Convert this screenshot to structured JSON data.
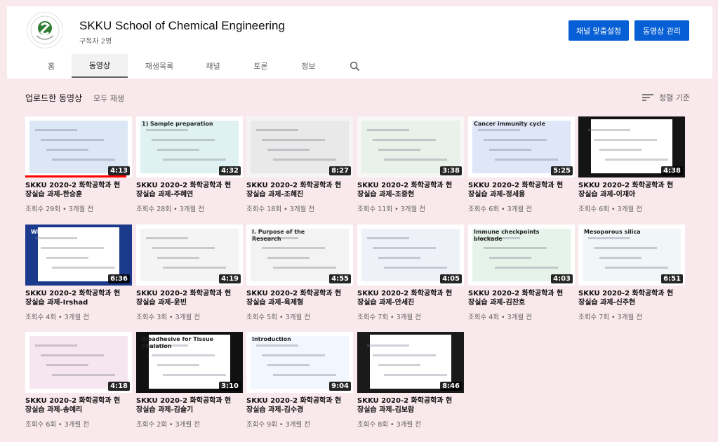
{
  "channel": {
    "name": "SKKU School of Chemical Engineering",
    "subscribers": "구독자 2명",
    "customize_label": "채널 맞춤설정",
    "manage_label": "동영상 관리"
  },
  "tabs": [
    {
      "label": "홈"
    },
    {
      "label": "동영상"
    },
    {
      "label": "재생목록"
    },
    {
      "label": "채널"
    },
    {
      "label": "토론"
    },
    {
      "label": "정보"
    }
  ],
  "section": {
    "title": "업로드한 동영상",
    "play_all": "모두 재생",
    "sort_label": "정렬 기준"
  },
  "videos": [
    {
      "title": "SKKU 2020-2 화학공학과 현장실습 과제-한승훈",
      "duration": "4:13",
      "meta": "조회수 29회 • 3개월 전",
      "watched": 0.95
    },
    {
      "title": "SKKU 2020-2 화학공학과 현장실습 과제-주혜연",
      "duration": "4:32",
      "meta": "조회수 28회 • 3개월 전",
      "watched": 0
    },
    {
      "title": "SKKU 2020-2 화학공학과 현장실습 과제-조혜진",
      "duration": "8:27",
      "meta": "조회수 18회 • 3개월 전",
      "watched": 0
    },
    {
      "title": "SKKU 2020-2 화학공학과 현장실습 과제-조중현",
      "duration": "3:38",
      "meta": "조회수 11회 • 3개월 전",
      "watched": 0
    },
    {
      "title": "SKKU 2020-2 화학공학과 현장실습 과제-정세융",
      "duration": "5:25",
      "meta": "조회수 6회 • 3개월 전",
      "watched": 0
    },
    {
      "title": "SKKU 2020-2 화학공학과 현장실습 과제-이재아",
      "duration": "4:38",
      "meta": "조회수 6회 • 3개월 전",
      "watched": 0
    },
    {
      "title": "SKKU 2020-2 화학공학과 현장실습 과제-Irshad",
      "duration": "6:36",
      "meta": "조회수 4회 • 3개월 전",
      "watched": 0
    },
    {
      "title": "SKKU 2020-2 화학공학과 현장실습 과제-윤빈",
      "duration": "4:19",
      "meta": "조회수 3회 • 3개월 전",
      "watched": 0
    },
    {
      "title": "SKKU 2020-2 화학공학과 현장실습 과제-육제형",
      "duration": "4:55",
      "meta": "조회수 5회 • 3개월 전",
      "watched": 0
    },
    {
      "title": "SKKU 2020-2 화학공학과 현장실습 과제-안세진",
      "duration": "4:05",
      "meta": "조회수 7회 • 3개월 전",
      "watched": 0
    },
    {
      "title": "SKKU 2020-2 화학공학과 현장실습 과제-김찬호",
      "duration": "4:03",
      "meta": "조회수 4회 • 3개월 전",
      "watched": 0
    },
    {
      "title": "SKKU 2020-2 화학공학과 현장실습 과제-신주현",
      "duration": "6:51",
      "meta": "조회수 7회 • 3개월 전",
      "watched": 0
    },
    {
      "title": "SKKU 2020-2 화학공학과 현장실습 과제-송예리",
      "duration": "4:18",
      "meta": "조회수 6회 • 3개월 전",
      "watched": 0
    },
    {
      "title": "SKKU 2020-2 화학공학과 현장실습 과제-김슬기",
      "duration": "3:10",
      "meta": "조회수 2회 • 3개월 전",
      "watched": 0
    },
    {
      "title": "SKKU 2020-2 화학공학과 현장실습 과제-김수경",
      "duration": "9:04",
      "meta": "조회수 9회 • 3개월 전",
      "watched": 0
    },
    {
      "title": "SKKU 2020-2 화학공학과 현장실습 과제-김보람",
      "duration": "8:46",
      "meta": "조회수 8회 • 3개월 전",
      "watched": 0
    }
  ],
  "thumb_texts": {
    "1": "1) Sample preparation",
    "4": "Cancer immunity cycle",
    "6": "What is Global Warming?",
    "8": "I. Purpose of the Research",
    "10": "Immune checkpoints blockade",
    "11": "Mesoporous silica",
    "13": "Bioadhesive for Tissue Sealation",
    "14": "Introduction"
  },
  "colors": {
    "accent": "#065fd4",
    "page_bg": "#f9e8ec"
  }
}
